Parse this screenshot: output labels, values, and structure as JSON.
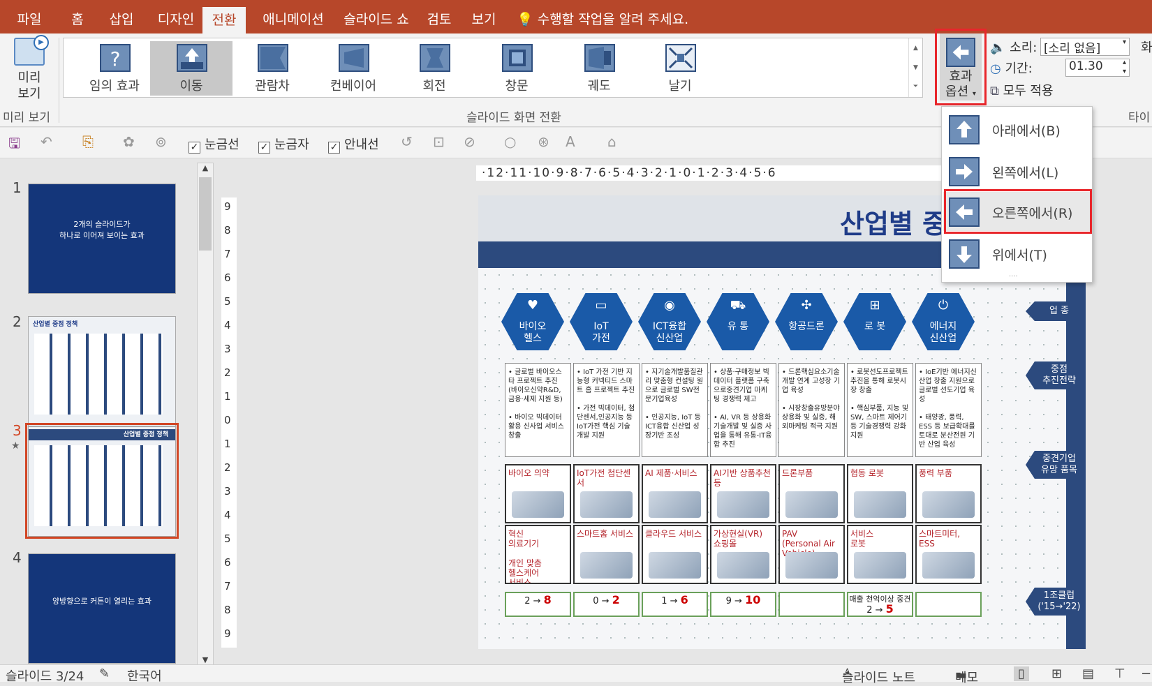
{
  "menu": {
    "tabs": [
      "파일",
      "홈",
      "삽입",
      "디자인",
      "전환",
      "애니메이션",
      "슬라이드 쇼",
      "검토",
      "보기"
    ],
    "active": "전환",
    "tell_me": "수행할 작업을 알려 주세요."
  },
  "ribbon": {
    "preview": {
      "label_line1": "미리",
      "label_line2": "보기",
      "group": "미리 보기"
    },
    "transitions": [
      "임의 효과",
      "이동",
      "관람차",
      "컨베이어",
      "회전",
      "창문",
      "궤도",
      "날기"
    ],
    "selected": "이동",
    "group_label": "슬라이드 화면 전환",
    "effect_options": {
      "line1": "효과",
      "line2": "옵션"
    },
    "sound_label": "소리:",
    "sound_value": "[소리 없음]",
    "duration_label": "기간:",
    "duration_value": "01.30",
    "apply_all": "모두 적용",
    "timing_group": "타이",
    "edge_labels": [
      "화"
    ]
  },
  "popup": {
    "items": [
      "아래에서(B)",
      "왼쪽에서(L)",
      "오른쪽에서(R)",
      "위에서(T)"
    ],
    "selected": "오른쪽에서(R)"
  },
  "toolbar": {
    "checkboxes": [
      "눈금선",
      "눈금자",
      "안내선"
    ]
  },
  "thumbnails": [
    {
      "num": "1",
      "text": "2개의 슬라이드가\n하나로 이어져 보이는 효과"
    },
    {
      "num": "2",
      "text": "산업별 중점 정책"
    },
    {
      "num": "3",
      "text": "산업별 중점 정책"
    },
    {
      "num": "4",
      "text": "양방향으로 커튼이 열리는 효과"
    }
  ],
  "ruler_h": "·12·11·10·9·8·7·6·5·4·3·2·1·0·1·2·3·4·5·6",
  "ruler_v": [
    "9",
    "8",
    "7",
    "6",
    "5",
    "4",
    "3",
    "2",
    "1",
    "0",
    "1",
    "2",
    "3",
    "4",
    "5",
    "6",
    "7",
    "8",
    "9"
  ],
  "slide": {
    "title": "산업별 중",
    "categories": [
      {
        "name": "바이오\n헬스",
        "icon": "heart-pulse-icon"
      },
      {
        "name": "IoT\n가전",
        "icon": "monitor-icon"
      },
      {
        "name": "ICT융합\n신산업",
        "icon": "ai-head-icon"
      },
      {
        "name": "유 통",
        "icon": "truck-icon"
      },
      {
        "name": "항공드론",
        "icon": "drone-icon"
      },
      {
        "name": "로 봇",
        "icon": "robot-icon"
      },
      {
        "name": "에너지\n신산업",
        "icon": "plug-icon"
      }
    ],
    "side_labels": [
      "업 종",
      "중점\n추진전략",
      "중견기업\n유망 품목",
      "1조클럽\n('15→'22)"
    ],
    "strategies": [
      "• 글로벌 바이오스타 프로젝트 추진 (바이오신약R&D, 금융·세제 지원 등)\n\n• 바이오 빅데이터 활용 신사업 서비스 창출",
      "• IoT 가전 기반 지능형 커넥티드 스마트 홈 프로젝트 추진\n\n• 가전 빅데이터, 첨단센서,인공지능 등 IoT가전 핵심 기술 개발 지원",
      "• 지기술개발품질관리 맞춤형 컨설팅 원으로 글로벌 SW전문기업육성\n\n• 인공지능, IoT 등 ICT융합 신산업 성장기반 조성",
      "• 상품·구매정보 빅데이터 플랫폼 구축으로중견기업 마케팅 경쟁력 제고\n\n• AI, VR 등 상용화 기술개발 및 실증 사업을 통해 유통-IT융합 추진",
      "• 드론핵심요소기술 개발 연계 고성장 기업 육성\n\n• 시장창출유망분야 상용화 및 실증, 해외마케팅 적극 지원",
      "• 로봇선도프로젝트 추진을 통해 로봇시장 창출\n\n• 핵심부품, 지능 및 SW, 스마트 제어기 등 기술경쟁력 강화 지원",
      "• IoE기반 에너지신산업 창출 지원으로 글로벌 선도기업 육성\n\n• 태양광, 풍력, ESS 등 보급확대를 토대로 분산전원 기반 산업 육성"
    ],
    "items_top": [
      "바이오 의약",
      "IoT가전 첨단센서",
      "AI 제품·서비스",
      "AI기반 상품추천 등",
      "드론부품",
      "협동 로봇",
      "풍력 부품"
    ],
    "items_bottom": [
      "혁신\n의료기기\n\n개인 맞춤\n헬스케어\n서비스",
      "스마트홈 서비스",
      "클라우드 서비스",
      "가상현실(VR)\n쇼핑몰",
      "PAV\n(Personal Air Vehicle)",
      "서비스\n로봇",
      "스마트미터, ESS"
    ],
    "clubs": [
      {
        "from": "2",
        "to": "8"
      },
      {
        "from": "0",
        "to": "2"
      },
      {
        "from": "1",
        "to": "6"
      },
      {
        "from": "9",
        "to": "10"
      },
      {
        "from": "",
        "to": ""
      },
      {
        "note": "매출 천억이상 중견",
        "from": "2",
        "to": "5"
      },
      {
        "from": "",
        "to": ""
      }
    ]
  },
  "status": {
    "slide": "슬라이드 3/24",
    "lang": "한국어",
    "notes": "슬라이드 노트",
    "comments": "메모"
  }
}
